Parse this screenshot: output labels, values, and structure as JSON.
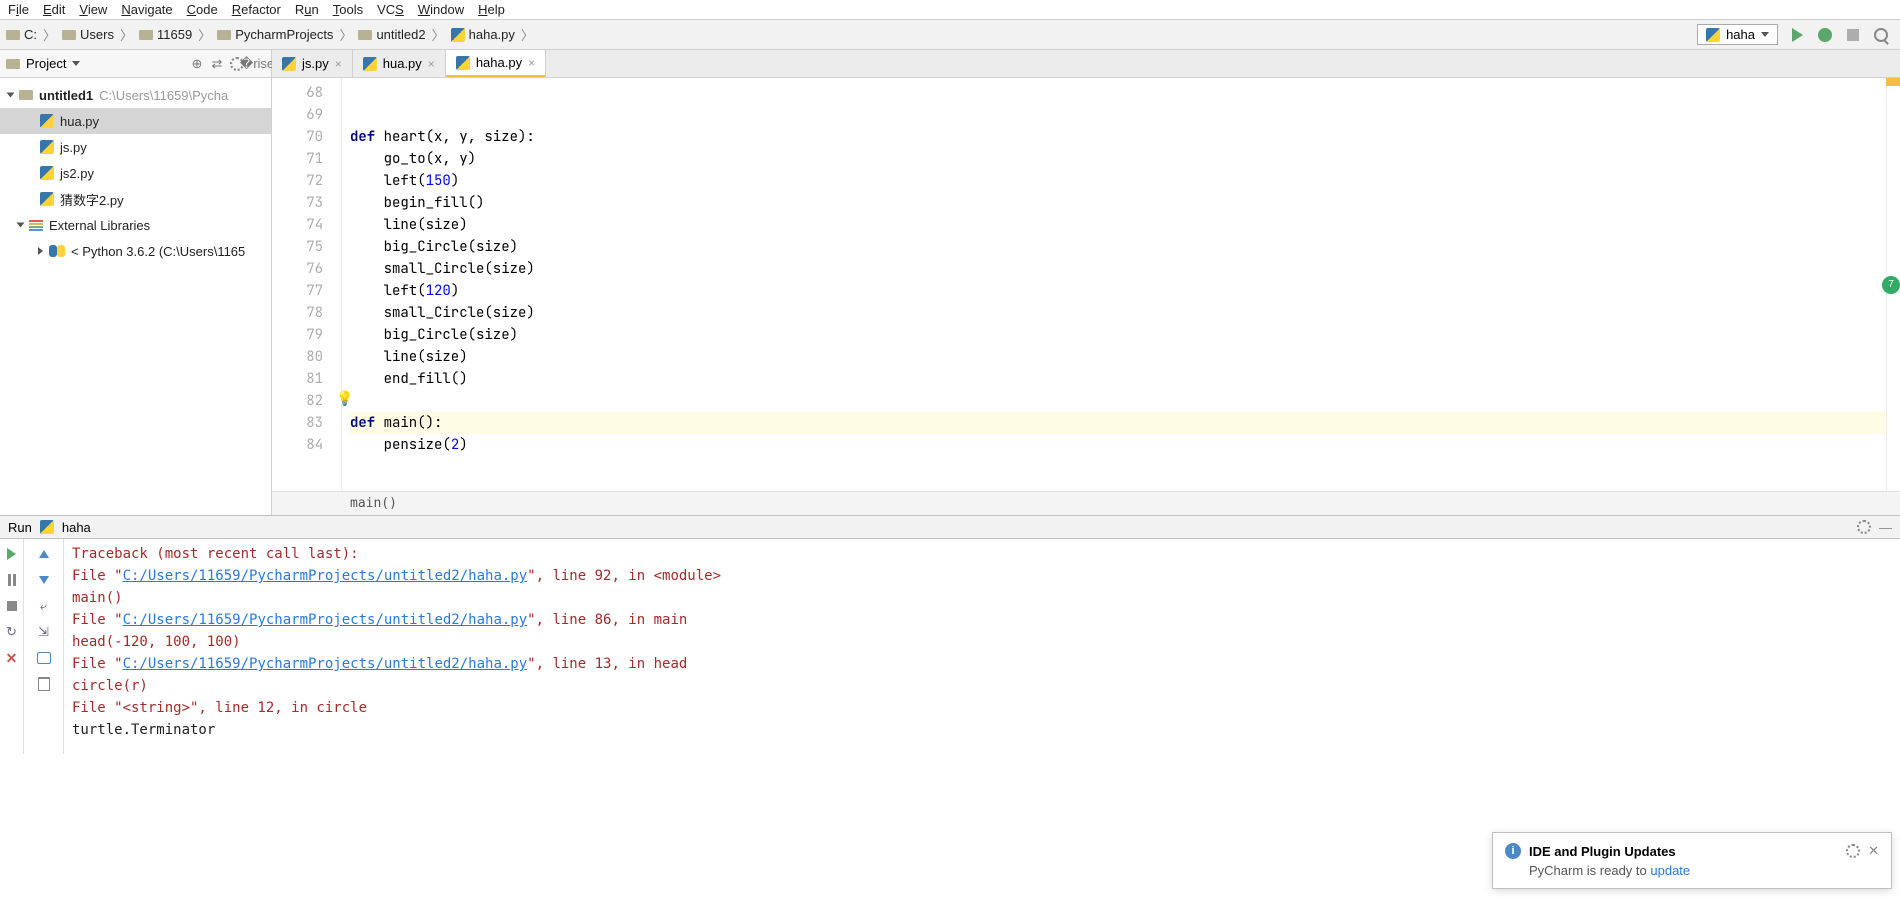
{
  "menu": [
    "File",
    "Edit",
    "View",
    "Navigate",
    "Code",
    "Refactor",
    "Run",
    "Tools",
    "VCS",
    "Window",
    "Help"
  ],
  "breadcrumbs": [
    "C:",
    "Users",
    "11659",
    "PycharmProjects",
    "untitled2",
    "haha.py"
  ],
  "run_config": "haha",
  "project": {
    "title": "Project",
    "root": {
      "name": "untitled1",
      "path": "C:\\Users\\11659\\Pycha"
    },
    "files": [
      "hua.py",
      "js.py",
      "js2.py",
      "猜数字2.py"
    ],
    "ext_lib": "External Libraries",
    "python": "< Python 3.6.2 (C:\\Users\\1165"
  },
  "tabs": [
    {
      "label": "js.py",
      "active": false
    },
    {
      "label": "hua.py",
      "active": false
    },
    {
      "label": "haha.py",
      "active": true
    }
  ],
  "editor": {
    "start": 68,
    "lines": [
      "",
      "",
      "def heart(x, y, size):",
      "    go_to(x, y)",
      "    left(150)",
      "    begin_fill()",
      "    line(size)",
      "    big_Circle(size)",
      "    small_Circle(size)",
      "    left(120)",
      "    small_Circle(size)",
      "    big_Circle(size)",
      "    line(size)",
      "    end_fill()",
      "",
      "def main():",
      "    pensize(2)"
    ],
    "highlight_line": 83,
    "crumb": "main()"
  },
  "run": {
    "title": "Run",
    "name": "haha",
    "console": [
      {
        "t": "err",
        "text": "Traceback (most recent call last):"
      },
      {
        "t": "file",
        "pre": "  File \"",
        "link": "C:/Users/11659/PycharmProjects/untitled2/haha.py",
        "post": "\", line 92, in <module>"
      },
      {
        "t": "err",
        "text": "    main()"
      },
      {
        "t": "file",
        "pre": "  File \"",
        "link": "C:/Users/11659/PycharmProjects/untitled2/haha.py",
        "post": "\", line 86, in main"
      },
      {
        "t": "err",
        "text": "    head(-120, 100, 100)"
      },
      {
        "t": "file",
        "pre": "  File \"",
        "link": "C:/Users/11659/PycharmProjects/untitled2/haha.py",
        "post": "\", line 13, in head"
      },
      {
        "t": "err",
        "text": "    circle(r)"
      },
      {
        "t": "err",
        "text": "  File \"<string>\", line 12, in circle"
      },
      {
        "t": "plain",
        "text": "turtle.Terminator"
      }
    ]
  },
  "notif": {
    "title": "IDE and Plugin Updates",
    "body_pre": "PyCharm is ready to ",
    "body_link": "update"
  }
}
